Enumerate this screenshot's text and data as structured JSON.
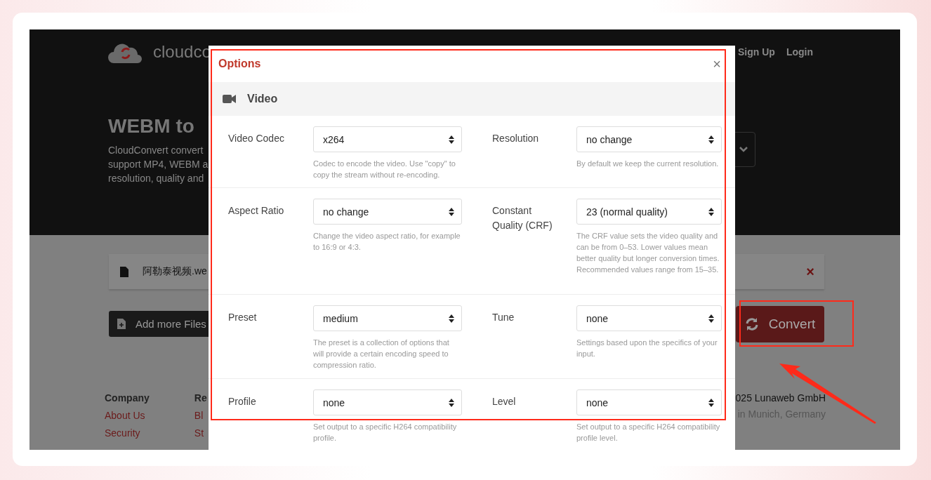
{
  "page": {
    "logo_text": "cloudco",
    "nav": [
      "Sign Up",
      "Login"
    ],
    "heading": "WEBM to",
    "intro": [
      "CloudConvert convert",
      "support MP4, WEBM a",
      "resolution, quality and"
    ],
    "file": {
      "name": "阿勒泰视频.we",
      "remove": "×"
    },
    "add_button": "Add more Files",
    "convert_button": "Convert",
    "footer": {
      "columns": [
        {
          "heading": "Company",
          "links": [
            "About Us",
            "Security"
          ]
        },
        {
          "heading": "Re",
          "links": [
            "Bl",
            "St"
          ]
        }
      ],
      "copyright": [
        "025 Lunaweb GmbH",
        "in Munich, Germany"
      ]
    }
  },
  "modal": {
    "title": "Options",
    "close": "×",
    "section": "Video",
    "fields": [
      {
        "label": "Video Codec",
        "value": "x264",
        "help": "Codec to encode the video. Use \"copy\" to copy the stream without re-encoding."
      },
      {
        "label": "Resolution",
        "value": "no change",
        "help": "By default we keep the current resolution."
      },
      {
        "label": "Aspect Ratio",
        "value": "no change",
        "help": "Change the video aspect ratio, for example to 16:9 or 4:3."
      },
      {
        "label": "Constant Quality (CRF)",
        "value": "23 (normal quality)",
        "help": "The CRF value sets the video quality and can be from 0–53. Lower values mean better quality but longer conversion times. Recommended values range from 15–35."
      },
      {
        "label": "Preset",
        "value": "medium",
        "help": "The preset is a collection of options that will provide a certain encoding speed to compression ratio."
      },
      {
        "label": "Tune",
        "value": "none",
        "help": "Settings based upon the specifics of your input."
      },
      {
        "label": "Profile",
        "value": "none",
        "help": "Set output to a specific H264 compatibility profile."
      },
      {
        "label": "Level",
        "value": "none",
        "help": "Set output to a specific H264 compatibility profile level."
      }
    ]
  }
}
